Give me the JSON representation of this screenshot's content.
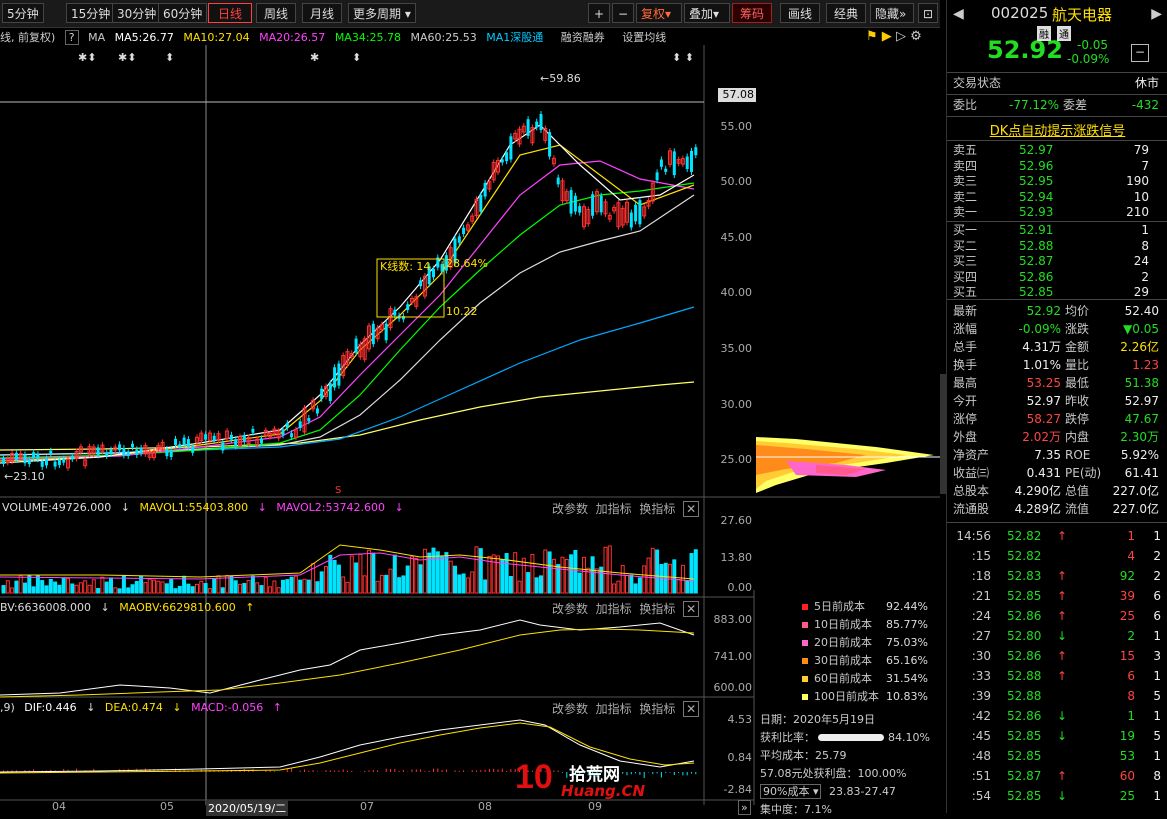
{
  "toolbar": {
    "periods": [
      "5分钟",
      "15分钟",
      "30分钟",
      "60分钟",
      "日线",
      "周线",
      "月线",
      "更多周期"
    ],
    "right_tools": [
      "+",
      "−",
      "复权",
      "叠加",
      "筹码",
      "画线",
      "经典",
      "隐藏"
    ]
  },
  "ma_line": {
    "prefix": "线, 前复权)",
    "help": "?",
    "ma": "MA",
    "ma5": "MA5:26.77",
    "ma10": "MA10:27.04",
    "ma20": "MA20:26.57",
    "ma34": "MA34:25.78",
    "ma60": "MA60:25.53",
    "ma1": "MA1深股通",
    "margin": "融资融券",
    "set_ma": "设置均线"
  },
  "price_axis": [
    "55.00",
    "50.00",
    "45.00",
    "40.00",
    "35.00",
    "30.00",
    "25.00"
  ],
  "price_marker": "57.08",
  "high_label": "59.86",
  "low_label": "23.10",
  "box": {
    "label": "K线数: 14",
    "pct": "28.64%",
    "val": "10.22"
  },
  "volume": {
    "label": "VOLUME:49726.000",
    "mavol1": "MAVOL1:55403.800",
    "mavol2": "MAVOL2:53742.600",
    "axis": [
      "27.60",
      "13.80",
      "0.00"
    ]
  },
  "obv": {
    "label": "BV:6636008.000",
    "maobv": "MAOBV:6629810.600",
    "axis": [
      "883.00",
      "741.00",
      "600.00"
    ]
  },
  "macd": {
    "prefix": ",9)",
    "dif": "DIF:0.446",
    "dea": "DEA:0.474",
    "macd": "MACD:-0.056",
    "axis": [
      "4.53",
      "0.84",
      "-2.84"
    ]
  },
  "panel_links": [
    "改参数",
    "加指标",
    "换指标"
  ],
  "x_axis": [
    "04",
    "05",
    "2020/05/19/二",
    "07",
    "08",
    "09"
  ],
  "costs": [
    {
      "label": "5日前成本",
      "pct": "92.44%",
      "color": "#ff2020"
    },
    {
      "label": "10日前成本",
      "pct": "85.77%",
      "color": "#ff5a8a"
    },
    {
      "label": "20日前成本",
      "pct": "75.03%",
      "color": "#ff66cc"
    },
    {
      "label": "30日前成本",
      "pct": "65.16%",
      "color": "#ff8c1a"
    },
    {
      "label": "60日前成本",
      "pct": "31.54%",
      "color": "#ffcc33"
    },
    {
      "label": "100日前成本",
      "pct": "10.83%",
      "color": "#ffff66"
    }
  ],
  "chip_info": {
    "date": "日期：2020年5月19日",
    "profit_label": "获利比率：",
    "profit_pct": "84.10%",
    "avg_cost": "平均成本：25.79",
    "profit_at": "57.08元处获利盘：100.00%",
    "cost_select": "90%成本",
    "cost_range": "23.83-27.47",
    "concentration": "集中度：7.1%"
  },
  "watermark": {
    "big": "10",
    "cn": "拾荒网",
    "url": "Huang.CN"
  },
  "quote": {
    "code": "002025",
    "name": "航天电器",
    "price": "52.92",
    "tag1": "融",
    "tag2": "通",
    "change": "-0.05",
    "change_pct": "-0.09%",
    "status_label": "交易状态",
    "status_value": "休市",
    "weibi_label": "委比",
    "weibi_value": "-77.12%",
    "weicha_label": "委差",
    "weicha_value": "-432",
    "dk_link": "DK点自动提示涨跌信号"
  },
  "asks": [
    {
      "label": "卖五",
      "price": "52.97",
      "vol": "79"
    },
    {
      "label": "卖四",
      "price": "52.96",
      "vol": "7"
    },
    {
      "label": "卖三",
      "price": "52.95",
      "vol": "190"
    },
    {
      "label": "卖二",
      "price": "52.94",
      "vol": "10"
    },
    {
      "label": "卖一",
      "price": "52.93",
      "vol": "210"
    }
  ],
  "bids": [
    {
      "label": "买一",
      "price": "52.91",
      "vol": "1"
    },
    {
      "label": "买二",
      "price": "52.88",
      "vol": "8"
    },
    {
      "label": "买三",
      "price": "52.87",
      "vol": "24"
    },
    {
      "label": "买四",
      "price": "52.86",
      "vol": "2"
    },
    {
      "label": "买五",
      "price": "52.85",
      "vol": "29"
    }
  ],
  "stats": [
    {
      "l1": "最新",
      "v1": "52.92",
      "c1": "grn",
      "l2": "均价",
      "v2": "52.40",
      "c2": "wht"
    },
    {
      "l1": "涨幅",
      "v1": "-0.09%",
      "c1": "grn",
      "l2": "涨跌",
      "v2": "▼0.05",
      "c2": "grn"
    },
    {
      "l1": "总手",
      "v1": "4.31万",
      "c1": "wht",
      "l2": "金额",
      "v2": "2.26亿",
      "c2": "yel"
    },
    {
      "l1": "换手",
      "v1": "1.01%",
      "c1": "wht",
      "l2": "量比",
      "v2": "1.23",
      "c2": "red"
    },
    {
      "l1": "最高",
      "v1": "53.25",
      "c1": "red",
      "l2": "最低",
      "v2": "51.38",
      "c2": "grn"
    },
    {
      "l1": "今开",
      "v1": "52.97",
      "c1": "wht",
      "l2": "昨收",
      "v2": "52.97",
      "c2": "wht"
    },
    {
      "l1": "涨停",
      "v1": "58.27",
      "c1": "red",
      "l2": "跌停",
      "v2": "47.67",
      "c2": "grn"
    },
    {
      "l1": "外盘",
      "v1": "2.02万",
      "c1": "red",
      "l2": "内盘",
      "v2": "2.30万",
      "c2": "grn"
    },
    {
      "l1": "净资产",
      "v1": "7.35",
      "c1": "wht",
      "l2": "ROE",
      "v2": "5.92%",
      "c2": "wht"
    },
    {
      "l1": "收益㈢",
      "v1": "0.431",
      "c1": "wht",
      "l2": "PE(动)",
      "v2": "61.41",
      "c2": "wht"
    },
    {
      "l1": "总股本",
      "v1": "4.290亿",
      "c1": "wht",
      "l2": "总值",
      "v2": "227.0亿",
      "c2": "wht"
    },
    {
      "l1": "流通股",
      "v1": "4.289亿",
      "c1": "wht",
      "l2": "流值",
      "v2": "227.0亿",
      "c2": "wht"
    }
  ],
  "ticks": [
    {
      "t": "14:56",
      "p": "52.82",
      "a": "↑",
      "ac": "red",
      "v": "1",
      "vc": "red",
      "n": "1"
    },
    {
      "t": ":15",
      "p": "52.82",
      "a": "",
      "ac": "red",
      "v": "4",
      "vc": "red",
      "n": "2"
    },
    {
      "t": ":18",
      "p": "52.83",
      "a": "↑",
      "ac": "red",
      "v": "92",
      "vc": "grn",
      "n": "2"
    },
    {
      "t": ":21",
      "p": "52.85",
      "a": "↑",
      "ac": "red",
      "v": "39",
      "vc": "red",
      "n": "6"
    },
    {
      "t": ":24",
      "p": "52.86",
      "a": "↑",
      "ac": "red",
      "v": "25",
      "vc": "red",
      "n": "6"
    },
    {
      "t": ":27",
      "p": "52.80",
      "a": "↓",
      "ac": "grn",
      "v": "2",
      "vc": "grn",
      "n": "1"
    },
    {
      "t": ":30",
      "p": "52.86",
      "a": "↑",
      "ac": "red",
      "v": "15",
      "vc": "red",
      "n": "3"
    },
    {
      "t": ":33",
      "p": "52.88",
      "a": "↑",
      "ac": "red",
      "v": "6",
      "vc": "red",
      "n": "1"
    },
    {
      "t": ":39",
      "p": "52.88",
      "a": "",
      "ac": "red",
      "v": "8",
      "vc": "red",
      "n": "5"
    },
    {
      "t": ":42",
      "p": "52.86",
      "a": "↓",
      "ac": "grn",
      "v": "1",
      "vc": "grn",
      "n": "1"
    },
    {
      "t": ":45",
      "p": "52.85",
      "a": "↓",
      "ac": "grn",
      "v": "19",
      "vc": "grn",
      "n": "5"
    },
    {
      "t": ":48",
      "p": "52.85",
      "a": "",
      "ac": "grn",
      "v": "53",
      "vc": "grn",
      "n": "1"
    },
    {
      "t": ":51",
      "p": "52.87",
      "a": "↑",
      "ac": "red",
      "v": "60",
      "vc": "red",
      "n": "8"
    },
    {
      "t": ":54",
      "p": "52.85",
      "a": "↓",
      "ac": "grn",
      "v": "25",
      "vc": "grn",
      "n": "1"
    }
  ]
}
